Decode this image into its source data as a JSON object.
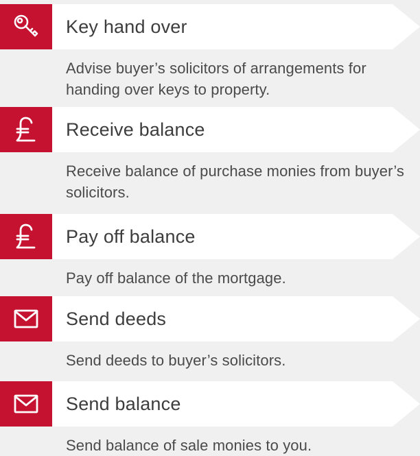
{
  "colors": {
    "accent": "#c41230",
    "header_bg": "#ffffff",
    "page_bg": "#f0f0f0",
    "text": "#444444"
  },
  "steps": [
    {
      "icon": "key-icon",
      "title": "Key hand over",
      "description": "Advise buyer’s solicitors of arrangements for handing over keys to property."
    },
    {
      "icon": "pound-icon",
      "title": "Receive balance",
      "description": "Receive balance of purchase monies from buyer’s solicitors."
    },
    {
      "icon": "pound-icon",
      "title": "Pay off balance",
      "description": "Pay off balance of the mortgage."
    },
    {
      "icon": "envelope-icon",
      "title": "Send deeds",
      "description": "Send deeds to buyer’s solicitors."
    },
    {
      "icon": "envelope-icon",
      "title": "Send balance",
      "description": "Send balance of sale monies to you."
    }
  ]
}
